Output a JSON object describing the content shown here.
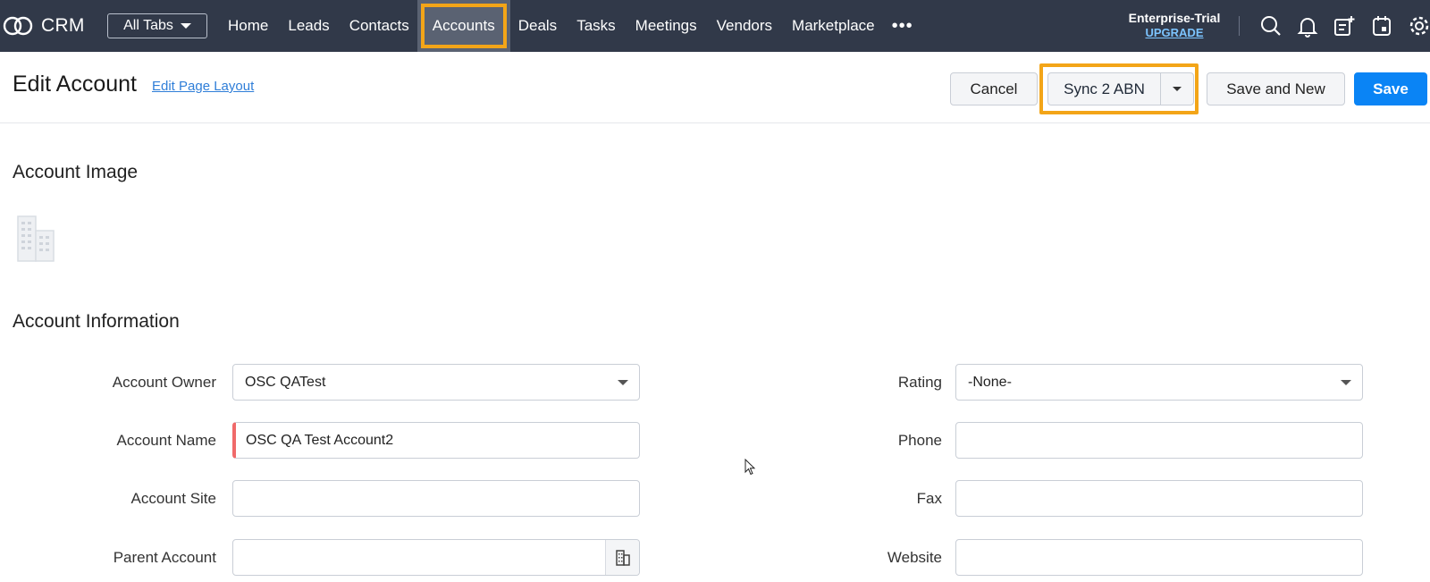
{
  "app": {
    "name": "CRM"
  },
  "nav": {
    "all_tabs": "All Tabs",
    "tabs": [
      "Home",
      "Leads",
      "Contacts",
      "Accounts",
      "Deals",
      "Tasks",
      "Meetings",
      "Vendors",
      "Marketplace"
    ],
    "active_tab": "Accounts",
    "more": "•••",
    "plan": "Enterprise-Trial",
    "upgrade": "UPGRADE",
    "icons": [
      "search-icon",
      "bell-icon",
      "note-add-icon",
      "calendar-icon",
      "gear-icon"
    ]
  },
  "header": {
    "title": "Edit Account",
    "edit_layout": "Edit Page Layout",
    "buttons": {
      "cancel": "Cancel",
      "sync": "Sync 2 ABN",
      "save_new": "Save and New",
      "save": "Save"
    }
  },
  "sections": {
    "image": "Account Image",
    "info": "Account Information"
  },
  "fields": {
    "account_owner": {
      "label": "Account Owner",
      "value": "OSC QATest"
    },
    "account_name": {
      "label": "Account Name",
      "value": "OSC QA Test Account2"
    },
    "account_site": {
      "label": "Account Site",
      "value": ""
    },
    "parent_account": {
      "label": "Parent Account",
      "value": ""
    },
    "rating": {
      "label": "Rating",
      "value": "-None-"
    },
    "phone": {
      "label": "Phone",
      "value": ""
    },
    "fax": {
      "label": "Fax",
      "value": ""
    },
    "website": {
      "label": "Website",
      "value": ""
    }
  },
  "colors": {
    "topbar": "#313949",
    "highlight": "#f3a518",
    "primary": "#0a84f5",
    "required": "#f06a6a"
  }
}
